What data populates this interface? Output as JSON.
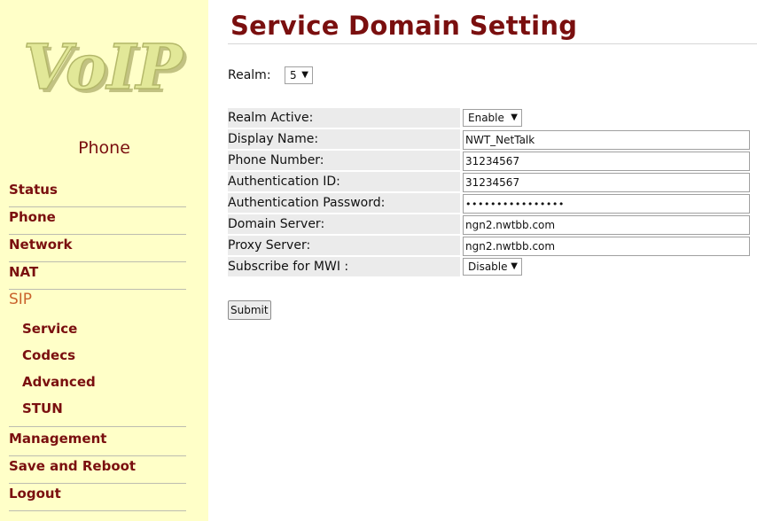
{
  "sidebar": {
    "logo_text": "VoIP",
    "model": "Phone",
    "nav": [
      "Status",
      "Phone",
      "Network",
      "NAT",
      "SIP"
    ],
    "sip_sub": [
      "Service",
      "Codecs",
      "Advanced",
      "STUN"
    ],
    "nav_bottom": [
      "Management",
      "Save and Reboot",
      "Logout"
    ]
  },
  "page": {
    "title": "Service Domain Setting",
    "realm_label": "Realm:",
    "realm_value": "5"
  },
  "form": {
    "realm_active": {
      "label": "Realm Active:",
      "value": "Enable"
    },
    "display_name": {
      "label": "Display Name:",
      "value": "NWT_NetTalk"
    },
    "phone_number": {
      "label": "Phone Number:",
      "value": "31234567"
    },
    "auth_id": {
      "label": "Authentication ID:",
      "value": "31234567"
    },
    "auth_password": {
      "label": "Authentication Password:",
      "value": "••••••••••••••••"
    },
    "domain_server": {
      "label": "Domain Server:",
      "value": "ngn2.nwtbb.com"
    },
    "proxy_server": {
      "label": "Proxy Server:",
      "value": "ngn2.nwtbb.com"
    },
    "subscribe_mwi": {
      "label": "Subscribe for MWI :",
      "value": "Disable"
    }
  },
  "submit_label": "Submit",
  "colors": {
    "sidebar_bg": "#ffffc8",
    "accent": "#7a0f0f",
    "active": "#c9622c"
  }
}
